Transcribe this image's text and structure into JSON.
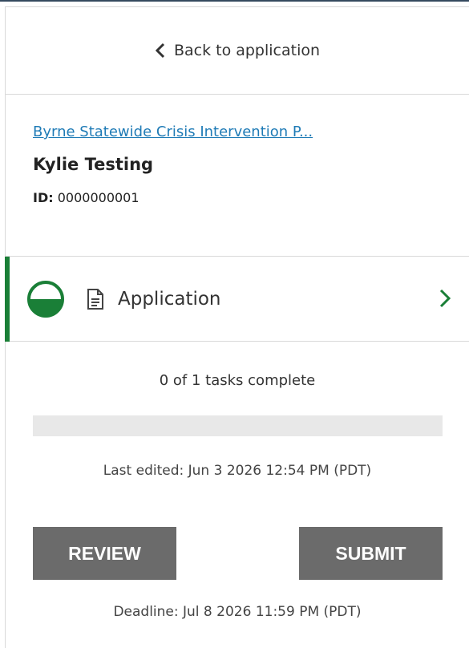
{
  "nav": {
    "back_label": "Back to application"
  },
  "application": {
    "program_link": "Byrne Statewide Crisis Intervention P...",
    "applicant_name": "Kylie Testing",
    "id_label": "ID:",
    "id_value": "0000000001"
  },
  "task": {
    "label": "Application",
    "status_icon": "half-complete-circle-icon",
    "doc_icon": "document-icon",
    "accent_color": "#1a7f37"
  },
  "progress": {
    "summary": "0 of 1 tasks complete",
    "completed": 0,
    "total": 1,
    "fraction": 0,
    "track_color": "#e8e8e8"
  },
  "last_edited": "Last edited: Jun 3 2026 12:54 PM (PDT)",
  "buttons": {
    "review_label": "REVIEW",
    "submit_label": "SUBMIT",
    "color": "#6b6b6b"
  },
  "deadline": "Deadline: Jul 8 2026 11:59 PM (PDT)",
  "colors": {
    "link": "#1f7bb6",
    "accent": "#1a7f37"
  }
}
